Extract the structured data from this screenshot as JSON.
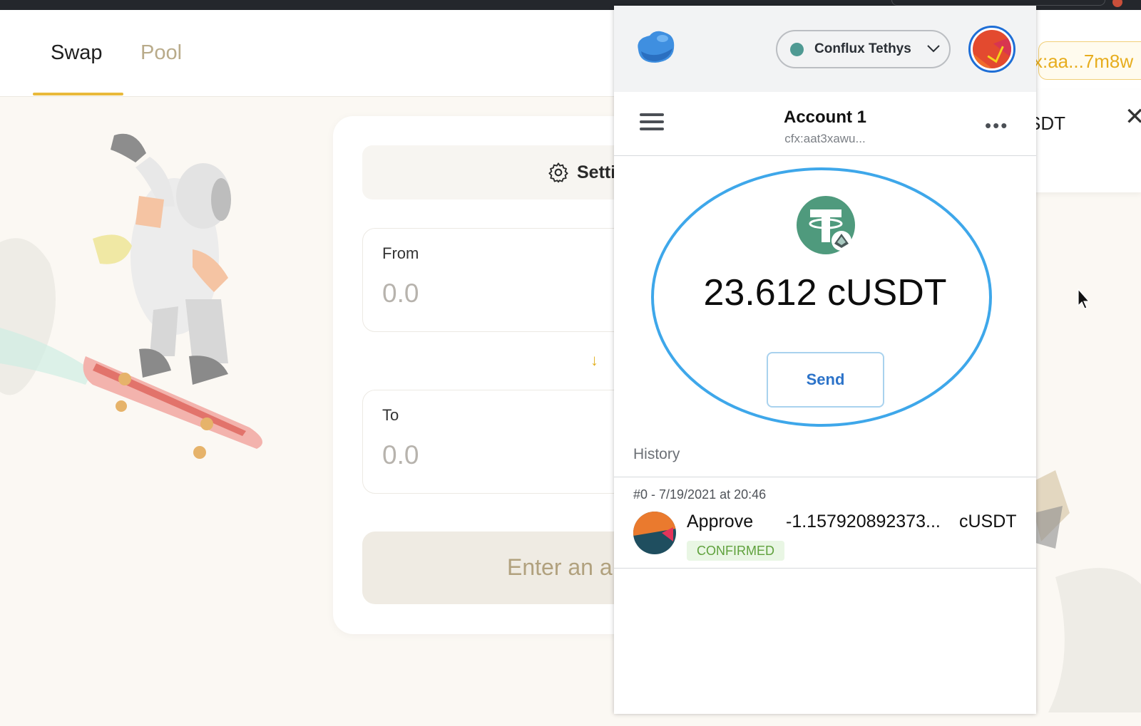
{
  "dapp": {
    "tabs": [
      {
        "label": "Swap",
        "active": true
      },
      {
        "label": "Pool",
        "active": false
      }
    ],
    "address_chip": "x:aa...7m8w",
    "settings_label": "Setti",
    "from": {
      "label": "From",
      "value": "0.0"
    },
    "to": {
      "label": "To",
      "value": "0.0"
    },
    "enter_button": "Enter an a",
    "modal_ticker": "SDT",
    "modal_close_icon": "close-icon",
    "accent_color": "#e9b93a"
  },
  "wallet": {
    "network": {
      "label": "Conflux Tethys",
      "dot_color": "#4f9a93"
    },
    "account": {
      "name": "Account 1",
      "address": "cfx:aat3xawu..."
    },
    "token": {
      "balance": "23.612 cUSDT",
      "icon": "tether-icon",
      "color": "#4f9a7d"
    },
    "send_label": "Send",
    "history_label": "History",
    "transactions": [
      {
        "date": "#0 - 7/19/2021 at 20:46",
        "title": "Approve",
        "amount": "-1.157920892373...",
        "symbol": "cUSDT",
        "status": "CONFIRMED"
      }
    ],
    "halo_color": "#3ea7ea"
  }
}
